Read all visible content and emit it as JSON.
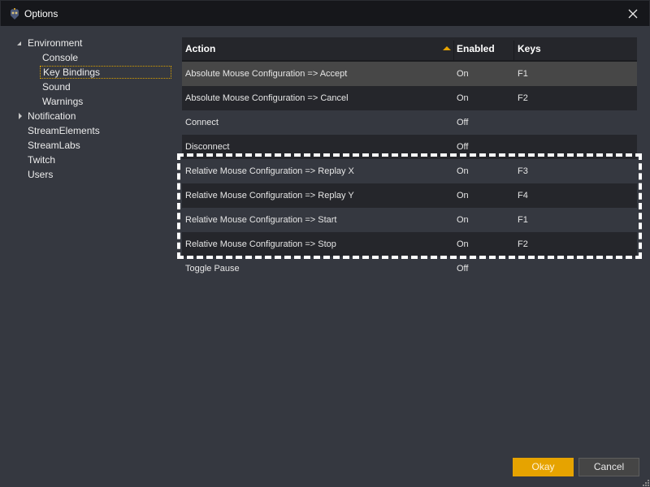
{
  "window": {
    "title": "Options",
    "app_icon": "app-logo-icon",
    "close_icon": "close-icon"
  },
  "tree": {
    "items": [
      {
        "label": "Environment",
        "level": 0,
        "expander": "expanded-triangle-icon"
      },
      {
        "label": "Console",
        "level": 1
      },
      {
        "label": "Key Bindings",
        "level": 1,
        "selected": true
      },
      {
        "label": "Sound",
        "level": 1
      },
      {
        "label": "Warnings",
        "level": 1
      },
      {
        "label": "Notification",
        "level": 0,
        "expander": "collapsed-triangle-icon"
      },
      {
        "label": "StreamElements",
        "level": 0
      },
      {
        "label": "StreamLabs",
        "level": 0
      },
      {
        "label": "Twitch",
        "level": 0
      },
      {
        "label": "Users",
        "level": 0
      }
    ]
  },
  "grid": {
    "columns": [
      {
        "label": "Action",
        "sort": "ascending"
      },
      {
        "label": "Enabled"
      },
      {
        "label": "Keys"
      }
    ],
    "rows": [
      {
        "action": "Absolute Mouse Configuration => Accept",
        "enabled": "On",
        "keys": "F1",
        "selected": true
      },
      {
        "action": "Absolute Mouse Configuration => Cancel",
        "enabled": "On",
        "keys": "F2"
      },
      {
        "action": "Connect",
        "enabled": "Off",
        "keys": ""
      },
      {
        "action": "Disconnect",
        "enabled": "Off",
        "keys": ""
      },
      {
        "action": "Relative Mouse Configuration => Replay X",
        "enabled": "On",
        "keys": "F3"
      },
      {
        "action": "Relative Mouse Configuration => Replay Y",
        "enabled": "On",
        "keys": "F4"
      },
      {
        "action": "Relative Mouse Configuration => Start",
        "enabled": "On",
        "keys": "F1"
      },
      {
        "action": "Relative Mouse Configuration => Stop",
        "enabled": "On",
        "keys": "F2"
      },
      {
        "action": "Toggle Pause",
        "enabled": "Off",
        "keys": ""
      }
    ]
  },
  "buttons": {
    "okay": "Okay",
    "cancel": "Cancel"
  },
  "colors": {
    "accent": "#e6a300",
    "background": "#353840",
    "titlebar": "#16171b",
    "row_dark": "#25262b",
    "row_selected": "#474747"
  }
}
